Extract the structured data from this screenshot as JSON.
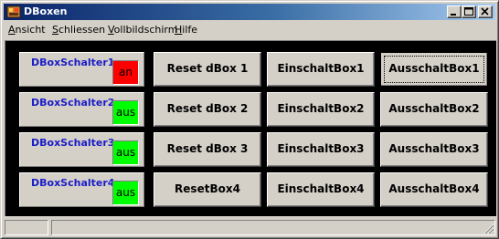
{
  "window": {
    "title": "DBoxen"
  },
  "menu": [
    {
      "accel": "A",
      "rest": "nsicht"
    },
    {
      "accel": "S",
      "rest": "chliessen"
    },
    {
      "accel": "V",
      "rest": "ollbildschirm"
    },
    {
      "accel": "H",
      "rest": "ilfe"
    }
  ],
  "rows": [
    {
      "switch_label": "DBoxSchalter1",
      "state": "an",
      "state_color": "#ff0000",
      "reset": "Reset dBox 1",
      "on": "EinschaltBox1",
      "off": "AusschaltBox1"
    },
    {
      "switch_label": "DBoxSchalter2",
      "state": "aus",
      "state_color": "#00ff00",
      "reset": "Reset dBox 2",
      "on": "EinschaltBox2",
      "off": "AusschaltBox2"
    },
    {
      "switch_label": "DBoxSchalter3",
      "state": "aus",
      "state_color": "#00ff00",
      "reset": "Reset dBox 3",
      "on": "EinschaltBox3",
      "off": "AusschaltBox3"
    },
    {
      "switch_label": "DBoxSchalter4",
      "state": "aus",
      "state_color": "#00ff00",
      "reset": "ResetBox4",
      "on": "EinschaltBox4",
      "off": "AusschaltBox4"
    }
  ],
  "icons": {
    "app": "dbox-app-icon",
    "minimize": "minimize-icon",
    "maximize": "maximize-icon",
    "close": "close-icon"
  },
  "colors": {
    "titlebar_start": "#0a246a",
    "titlebar_end": "#a6caf0",
    "switch_label": "#1c1cc8",
    "client_bg": "#000000"
  }
}
